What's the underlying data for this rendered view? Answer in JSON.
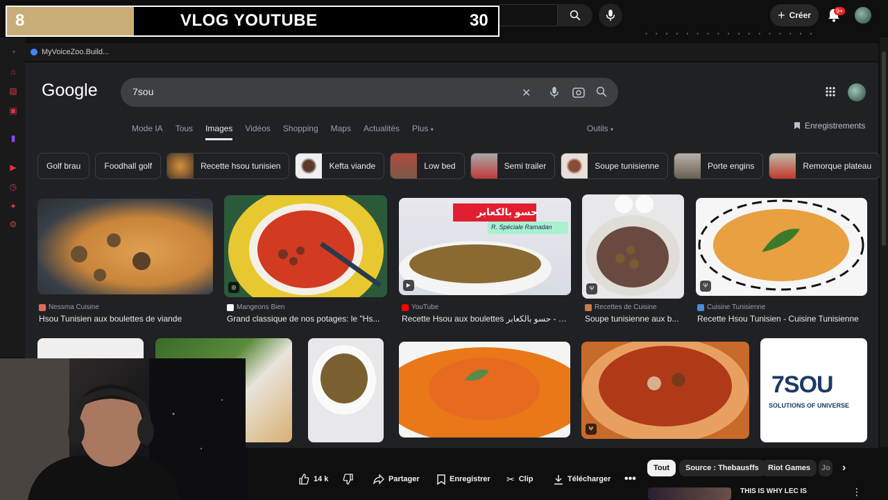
{
  "overlay": {
    "left_number": "8",
    "title": "VLOG YOUTUBE",
    "right_number": "30"
  },
  "yt_header": {
    "create_label": "Créer",
    "notif_badge": "9+"
  },
  "bookmark": {
    "label": "MyVoiceZoo.Build..."
  },
  "google": {
    "logo": "Google",
    "query": "7sou",
    "tabs": [
      {
        "label": "Mode IA"
      },
      {
        "label": "Tous"
      },
      {
        "label": "Images",
        "active": true
      },
      {
        "label": "Vidéos"
      },
      {
        "label": "Shopping"
      },
      {
        "label": "Maps"
      },
      {
        "label": "Actualités"
      },
      {
        "label": "Plus"
      }
    ],
    "tools_label": "Outils",
    "saved_label": "Enregistrements",
    "chips": [
      {
        "label": "Golf brau"
      },
      {
        "label": "Foodhall golf"
      },
      {
        "label": "Recette hsou tunisien"
      },
      {
        "label": "Kefta viande"
      },
      {
        "label": "Low bed"
      },
      {
        "label": "Semi trailer"
      },
      {
        "label": "Soupe tunisienne"
      },
      {
        "label": "Porte engins"
      },
      {
        "label": "Remorque plateau"
      }
    ],
    "results": [
      {
        "source": "Nessma Cuisine",
        "title": "Hsou Tunisien aux boulettes de viande",
        "source_color": "#e06c5c"
      },
      {
        "source": "Mangeons Bien",
        "title": "Grand classique de nos potages: le \"Hs...",
        "source_color": "#ffffff"
      },
      {
        "source": "YouTube",
        "title": "Recette Hsou aux boulettes حسو بالكعابر - Yo...",
        "source_color": "#ff0000",
        "overlay_ar": "حسو بالكعابر",
        "overlay_fr": "R. Spéciale Ramadan"
      },
      {
        "source": "Recettes de Cuisine",
        "title": "Soupe tunisienne aux b...",
        "source_color": "#c97b4a"
      },
      {
        "source": "Cuisine Tunisienne",
        "title": "Recette Hsou Tunisien - Cuisine Tunisienne",
        "source_color": "#4a8ad8"
      }
    ],
    "logo_card": {
      "brand": "7SOU",
      "tagline": "SOLUTIONS OF UNIVERSE"
    }
  },
  "yt_actions": {
    "likes": "14 k",
    "share": "Partager",
    "save": "Enregistrer",
    "clip": "Clip",
    "download": "Télécharger"
  },
  "yt_filters": [
    {
      "label": "Tout",
      "active": true
    },
    {
      "label": "Source : Thebausffs"
    },
    {
      "label": "Riot Games"
    },
    {
      "label": "Jo"
    }
  ],
  "next_video": {
    "title": "THIS IS WHY LEC IS"
  }
}
